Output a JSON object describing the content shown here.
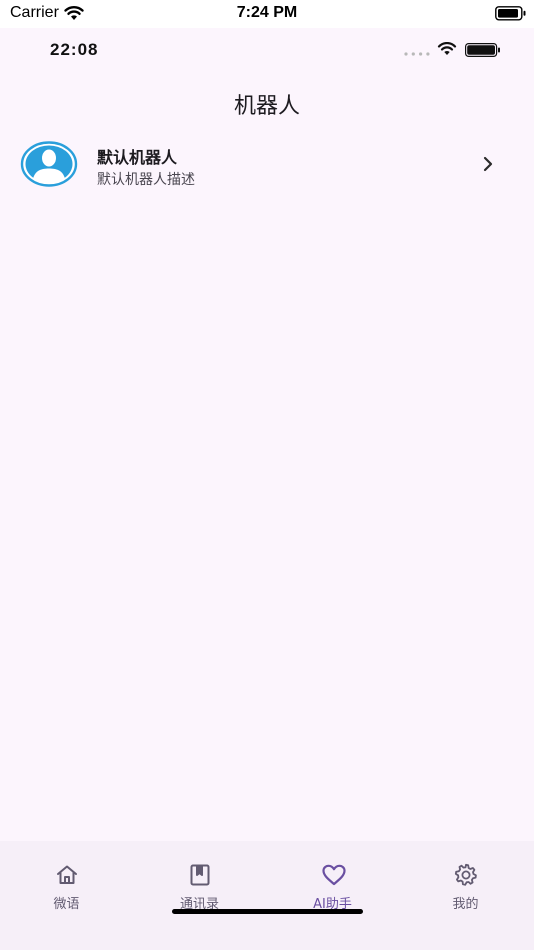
{
  "system_status": {
    "carrier": "Carrier",
    "time": "7:24 PM"
  },
  "app_status": {
    "time": "22:08"
  },
  "header": {
    "title": "机器人"
  },
  "bots": [
    {
      "name": "默认机器人",
      "description": "默认机器人描述",
      "avatar_icon": "user-avatar-icon"
    }
  ],
  "tabs": [
    {
      "label": "微语",
      "icon": "home-icon",
      "active": false
    },
    {
      "label": "通讯录",
      "icon": "bookmark-book-icon",
      "active": false
    },
    {
      "label": "AI助手",
      "icon": "heart-icon",
      "active": true
    },
    {
      "label": "我的",
      "icon": "gear-icon",
      "active": false
    }
  ],
  "colors": {
    "app_background": "#fcf5fd",
    "tabbar_background": "#f6eff8",
    "accent": "#6a4fa1",
    "avatar_blue": "#2a9fdb",
    "inactive_tab": "#625b71"
  }
}
